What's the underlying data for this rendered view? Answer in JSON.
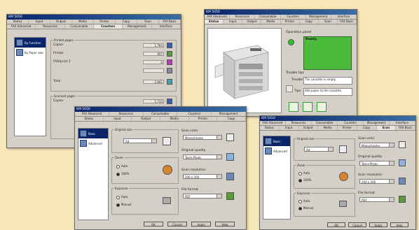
{
  "window1": {
    "title": "KM 5050",
    "tabs_row1": [
      "Status",
      "Input",
      "Output",
      "Media",
      "Printer",
      "Copy",
      "Scan",
      "FAX Basic"
    ],
    "tabs_row2": [
      "FAX Advanced",
      "Resources",
      "Consumable",
      "Counters",
      "Management",
      "Interface"
    ],
    "sidebar": [
      "By Function",
      "By Paper size"
    ],
    "printed_group": "Printed pages",
    "printed_rows": [
      {
        "label": "Copier",
        "value": "1,794"
      },
      {
        "label": "Printer",
        "value": "957"
      },
      {
        "label": "FAX/print 1",
        "value": "0"
      },
      {
        "label": "",
        "value": ""
      },
      {
        "label": "Total",
        "value": "2,801"
      }
    ],
    "scanned_group": "Scanned pages",
    "scanned_rows": [
      {
        "label": "Copier",
        "value": "1,733"
      }
    ]
  },
  "window2": {
    "title": "KM 5050",
    "tabs_row1": [
      "FAX Advanced",
      "Resources",
      "Consumable",
      "Counters",
      "Management",
      "Interface"
    ],
    "tabs_row2": [
      "Status",
      "Input",
      "Output",
      "Media",
      "Printer",
      "Copy",
      "Scan",
      "FAX Basic"
    ],
    "operation_panel_label": "Operation panel",
    "lcd_text": "Ready.",
    "trouble_tips_label": "Trouble tips",
    "trouble_label": "Trouble",
    "trouble_text": "The cassette is empty.",
    "tips_label": "Tips",
    "tips_text": "Add paper to the cassette."
  },
  "window3": {
    "title": "KM 5050",
    "tabs_row1": [
      "FAX Advanced",
      "Resources",
      "Consumable",
      "Counters",
      "Management"
    ],
    "tabs_row2": [
      "Status",
      "Input",
      "Output",
      "Media",
      "Printer",
      "Copy"
    ],
    "sidebar": [
      "Basic",
      "Advanced"
    ],
    "original_size_label": "Original size",
    "original_size_value": "A4",
    "zoom_label": "Zoom",
    "zoom_options": [
      "Auto",
      "100%"
    ],
    "exposure_label": "Exposure",
    "exposure_options": [
      "Auto",
      "Manual"
    ],
    "scan_color_label": "Scan color",
    "scan_color_value": "Monochrome",
    "original_quality_label": "Original quality",
    "original_quality_value": "Text+Photo",
    "scan_resolution_label": "Scan resolution",
    "scan_resolution_value": "200 x 200",
    "file_format_label": "File format",
    "file_format_value": "PDF",
    "buttons": [
      "OK",
      "Cancel",
      "Apply",
      "Help"
    ]
  },
  "window4": {
    "title": "KM 5050",
    "tabs_row1": [
      "FAX Advanced",
      "Resources",
      "Consumable",
      "Counters",
      "Management",
      "Interface"
    ],
    "tabs_row2": [
      "Status",
      "Input",
      "Output",
      "Media",
      "Printer",
      "Copy",
      "Scan",
      "FAX Basic"
    ],
    "sidebar": [
      "Basic",
      "Advanced"
    ],
    "original_size_label": "Original size",
    "original_size_value": "A4",
    "zoom_label": "Zoom",
    "zoom_options": [
      "Auto",
      "100%"
    ],
    "exposure_label": "Exposure",
    "exposure_options": [
      "Auto",
      "Manual"
    ],
    "scan_color_label": "Scan color",
    "scan_color_value": "Monochrome",
    "original_quality_label": "Original quality",
    "original_quality_value": "Text+Photo",
    "scan_resolution_label": "Scan resolution",
    "scan_resolution_value": "200 x 200",
    "file_format_label": "File format",
    "file_format_value": "PDF",
    "buttons": [
      "OK",
      "Cancel",
      "Apply",
      "Help"
    ]
  },
  "colors": {
    "background": "#f7e6b8",
    "lcd": "#4cbb3c",
    "titlebar": "#0a246a"
  }
}
